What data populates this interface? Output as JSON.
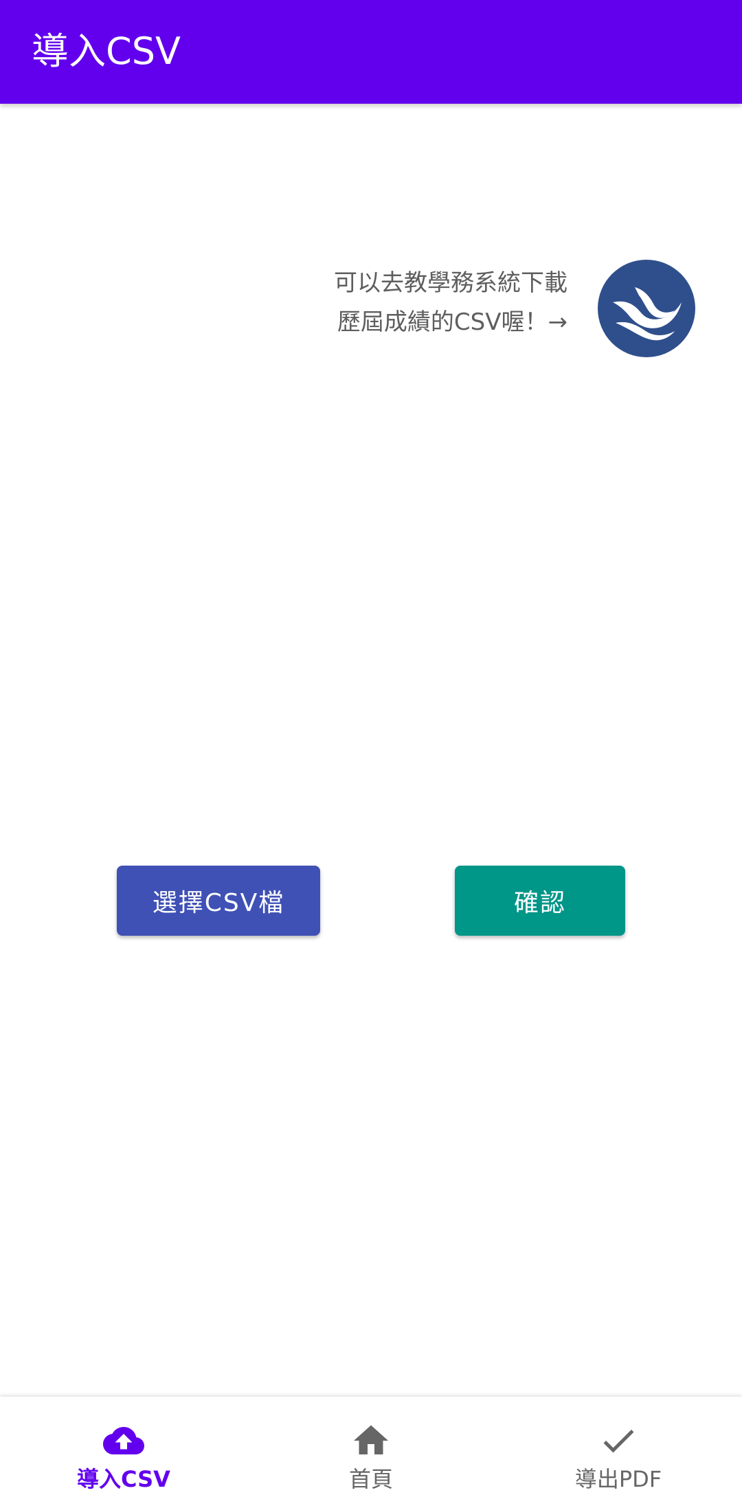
{
  "app_bar": {
    "title": "導入CSV",
    "color": "#6200ee"
  },
  "hint": {
    "line1": "可以去教學務系統下載",
    "line2": "歷屆成績的CSV喔！→",
    "logo_icon": "ntnu-logo-icon",
    "logo_color": "#2f4f8c"
  },
  "buttons": {
    "choose_csv": "選擇CSV檔",
    "choose_color": "#3f51b5",
    "confirm": "確認",
    "confirm_color": "#009688"
  },
  "bottom_nav": {
    "active_color": "#6200ee",
    "items": [
      {
        "label": "導入CSV",
        "icon": "cloud-upload-icon",
        "active": true
      },
      {
        "label": "首頁",
        "icon": "home-icon",
        "active": false
      },
      {
        "label": "導出PDF",
        "icon": "check-icon",
        "active": false
      }
    ]
  }
}
